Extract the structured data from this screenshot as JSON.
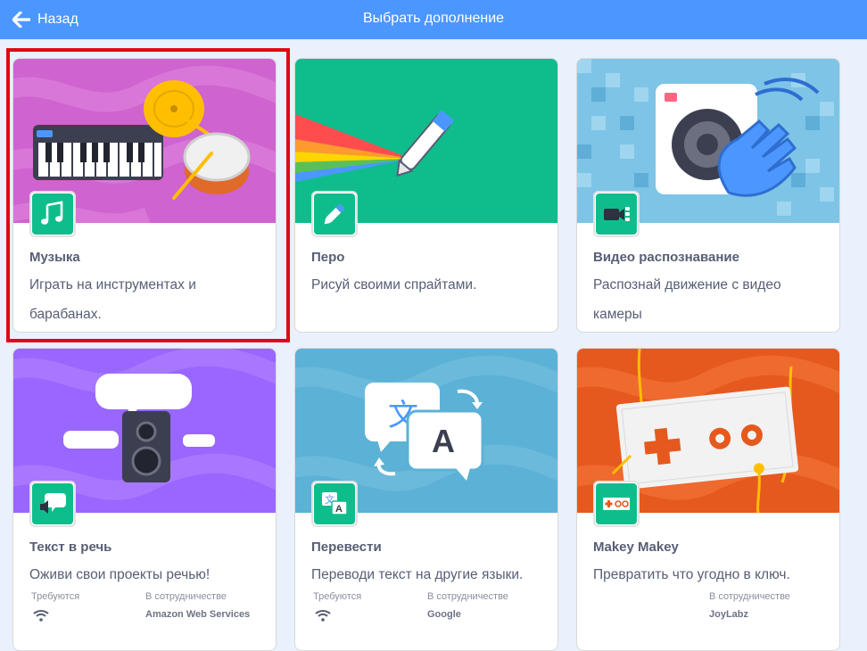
{
  "header": {
    "back_label": "Назад",
    "title": "Выбрать дополнение"
  },
  "colors": {
    "header_bg": "#4c97ff",
    "badge_green": "#0fbd8c",
    "selection_red": "#e30613",
    "page_bg": "#e9f1fc"
  },
  "cards": [
    {
      "title": "Музыка",
      "description": "Играть на инструментах и барабанах.",
      "icon": "music-notes-icon",
      "selected": true
    },
    {
      "title": "Перо",
      "description": "Рисуй своими спрайтами.",
      "icon": "pen-icon",
      "selected": false
    },
    {
      "title": "Видео распознавание",
      "description": "Распознай движение с видео камеры",
      "icon": "video-camera-icon",
      "selected": false
    },
    {
      "title": "Текст в речь",
      "description": "Оживи свои проекты речью!",
      "icon": "speech-bubble-icon",
      "requires_label": "Требуются",
      "requires_icon": "wifi-icon",
      "collab_label": "В сотрудничестве",
      "collab_value": "Amazon Web Services"
    },
    {
      "title": "Перевести",
      "description": "Переводи текст на другие языки.",
      "icon": "translate-icon",
      "requires_label": "Требуются",
      "requires_icon": "wifi-icon",
      "collab_label": "В сотрудничестве",
      "collab_value": "Google"
    },
    {
      "title": "Makey Makey",
      "description": "Превратить что угодно в ключ.",
      "icon": "makey-makey-icon",
      "collab_label": "В сотрудничестве",
      "collab_value": "JoyLabz"
    }
  ]
}
